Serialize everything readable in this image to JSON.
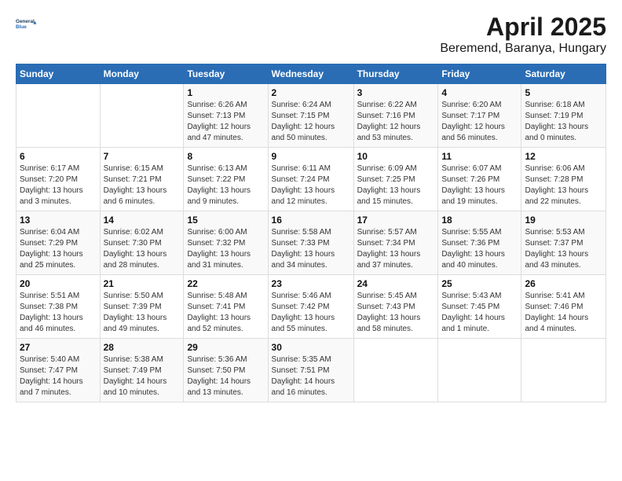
{
  "logo": {
    "line1": "General",
    "line2": "Blue"
  },
  "title": "April 2025",
  "subtitle": "Beremend, Baranya, Hungary",
  "weekdays": [
    "Sunday",
    "Monday",
    "Tuesday",
    "Wednesday",
    "Thursday",
    "Friday",
    "Saturday"
  ],
  "weeks": [
    [
      {
        "day": "",
        "content": ""
      },
      {
        "day": "",
        "content": ""
      },
      {
        "day": "1",
        "content": "Sunrise: 6:26 AM\nSunset: 7:13 PM\nDaylight: 12 hours\nand 47 minutes."
      },
      {
        "day": "2",
        "content": "Sunrise: 6:24 AM\nSunset: 7:15 PM\nDaylight: 12 hours\nand 50 minutes."
      },
      {
        "day": "3",
        "content": "Sunrise: 6:22 AM\nSunset: 7:16 PM\nDaylight: 12 hours\nand 53 minutes."
      },
      {
        "day": "4",
        "content": "Sunrise: 6:20 AM\nSunset: 7:17 PM\nDaylight: 12 hours\nand 56 minutes."
      },
      {
        "day": "5",
        "content": "Sunrise: 6:18 AM\nSunset: 7:19 PM\nDaylight: 13 hours\nand 0 minutes."
      }
    ],
    [
      {
        "day": "6",
        "content": "Sunrise: 6:17 AM\nSunset: 7:20 PM\nDaylight: 13 hours\nand 3 minutes."
      },
      {
        "day": "7",
        "content": "Sunrise: 6:15 AM\nSunset: 7:21 PM\nDaylight: 13 hours\nand 6 minutes."
      },
      {
        "day": "8",
        "content": "Sunrise: 6:13 AM\nSunset: 7:22 PM\nDaylight: 13 hours\nand 9 minutes."
      },
      {
        "day": "9",
        "content": "Sunrise: 6:11 AM\nSunset: 7:24 PM\nDaylight: 13 hours\nand 12 minutes."
      },
      {
        "day": "10",
        "content": "Sunrise: 6:09 AM\nSunset: 7:25 PM\nDaylight: 13 hours\nand 15 minutes."
      },
      {
        "day": "11",
        "content": "Sunrise: 6:07 AM\nSunset: 7:26 PM\nDaylight: 13 hours\nand 19 minutes."
      },
      {
        "day": "12",
        "content": "Sunrise: 6:06 AM\nSunset: 7:28 PM\nDaylight: 13 hours\nand 22 minutes."
      }
    ],
    [
      {
        "day": "13",
        "content": "Sunrise: 6:04 AM\nSunset: 7:29 PM\nDaylight: 13 hours\nand 25 minutes."
      },
      {
        "day": "14",
        "content": "Sunrise: 6:02 AM\nSunset: 7:30 PM\nDaylight: 13 hours\nand 28 minutes."
      },
      {
        "day": "15",
        "content": "Sunrise: 6:00 AM\nSunset: 7:32 PM\nDaylight: 13 hours\nand 31 minutes."
      },
      {
        "day": "16",
        "content": "Sunrise: 5:58 AM\nSunset: 7:33 PM\nDaylight: 13 hours\nand 34 minutes."
      },
      {
        "day": "17",
        "content": "Sunrise: 5:57 AM\nSunset: 7:34 PM\nDaylight: 13 hours\nand 37 minutes."
      },
      {
        "day": "18",
        "content": "Sunrise: 5:55 AM\nSunset: 7:36 PM\nDaylight: 13 hours\nand 40 minutes."
      },
      {
        "day": "19",
        "content": "Sunrise: 5:53 AM\nSunset: 7:37 PM\nDaylight: 13 hours\nand 43 minutes."
      }
    ],
    [
      {
        "day": "20",
        "content": "Sunrise: 5:51 AM\nSunset: 7:38 PM\nDaylight: 13 hours\nand 46 minutes."
      },
      {
        "day": "21",
        "content": "Sunrise: 5:50 AM\nSunset: 7:39 PM\nDaylight: 13 hours\nand 49 minutes."
      },
      {
        "day": "22",
        "content": "Sunrise: 5:48 AM\nSunset: 7:41 PM\nDaylight: 13 hours\nand 52 minutes."
      },
      {
        "day": "23",
        "content": "Sunrise: 5:46 AM\nSunset: 7:42 PM\nDaylight: 13 hours\nand 55 minutes."
      },
      {
        "day": "24",
        "content": "Sunrise: 5:45 AM\nSunset: 7:43 PM\nDaylight: 13 hours\nand 58 minutes."
      },
      {
        "day": "25",
        "content": "Sunrise: 5:43 AM\nSunset: 7:45 PM\nDaylight: 14 hours\nand 1 minute."
      },
      {
        "day": "26",
        "content": "Sunrise: 5:41 AM\nSunset: 7:46 PM\nDaylight: 14 hours\nand 4 minutes."
      }
    ],
    [
      {
        "day": "27",
        "content": "Sunrise: 5:40 AM\nSunset: 7:47 PM\nDaylight: 14 hours\nand 7 minutes."
      },
      {
        "day": "28",
        "content": "Sunrise: 5:38 AM\nSunset: 7:49 PM\nDaylight: 14 hours\nand 10 minutes."
      },
      {
        "day": "29",
        "content": "Sunrise: 5:36 AM\nSunset: 7:50 PM\nDaylight: 14 hours\nand 13 minutes."
      },
      {
        "day": "30",
        "content": "Sunrise: 5:35 AM\nSunset: 7:51 PM\nDaylight: 14 hours\nand 16 minutes."
      },
      {
        "day": "",
        "content": ""
      },
      {
        "day": "",
        "content": ""
      },
      {
        "day": "",
        "content": ""
      }
    ]
  ]
}
